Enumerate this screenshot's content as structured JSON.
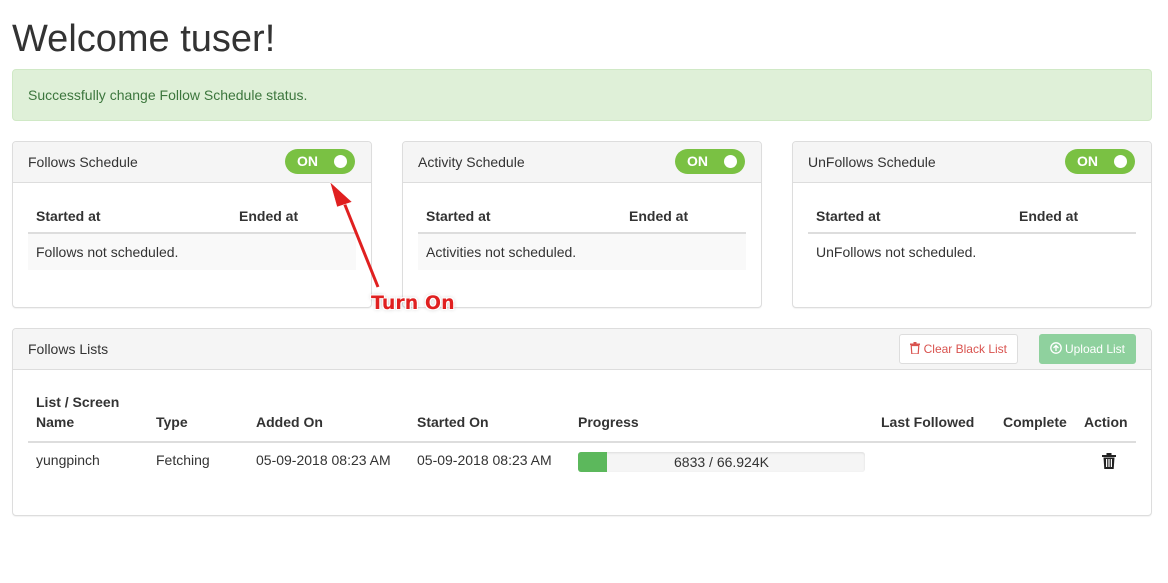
{
  "page": {
    "title": "Welcome tuser!"
  },
  "alert": {
    "message": "Successfully change Follow Schedule status."
  },
  "schedules": [
    {
      "title": "Follows Schedule",
      "toggle": "ON",
      "col_started": "Started at",
      "col_ended": "Ended at",
      "empty": "Follows not scheduled."
    },
    {
      "title": "Activity Schedule",
      "toggle": "ON",
      "col_started": "Started at",
      "col_ended": "Ended at",
      "empty": "Activities not scheduled."
    },
    {
      "title": "UnFollows Schedule",
      "toggle": "ON",
      "col_started": "Started at",
      "col_ended": "Ended at",
      "empty": "UnFollows not scheduled."
    }
  ],
  "lists_panel": {
    "title": "Follows Lists",
    "clear_button": "Clear Black List",
    "upload_button": "Upload List",
    "columns": [
      "List / Screen Name",
      "Type",
      "Added On",
      "Started On",
      "Progress",
      "Last Followed",
      "Complete",
      "Action"
    ],
    "rows": [
      {
        "name": "yungpinch",
        "type": "Fetching",
        "added_on": "05-09-2018 08:23 AM",
        "started_on": "05-09-2018 08:23 AM",
        "progress_text": "6833 / 66.924K",
        "progress_fraction": 0.102,
        "last_followed": "",
        "complete": ""
      }
    ]
  },
  "annotation": {
    "label": "Turn On"
  },
  "colors": {
    "toggle_on": "#7ac143",
    "alert_bg": "#dff0d8",
    "alert_text": "#3c763d",
    "progress": "#5cb85c",
    "annotation": "#e02020"
  }
}
